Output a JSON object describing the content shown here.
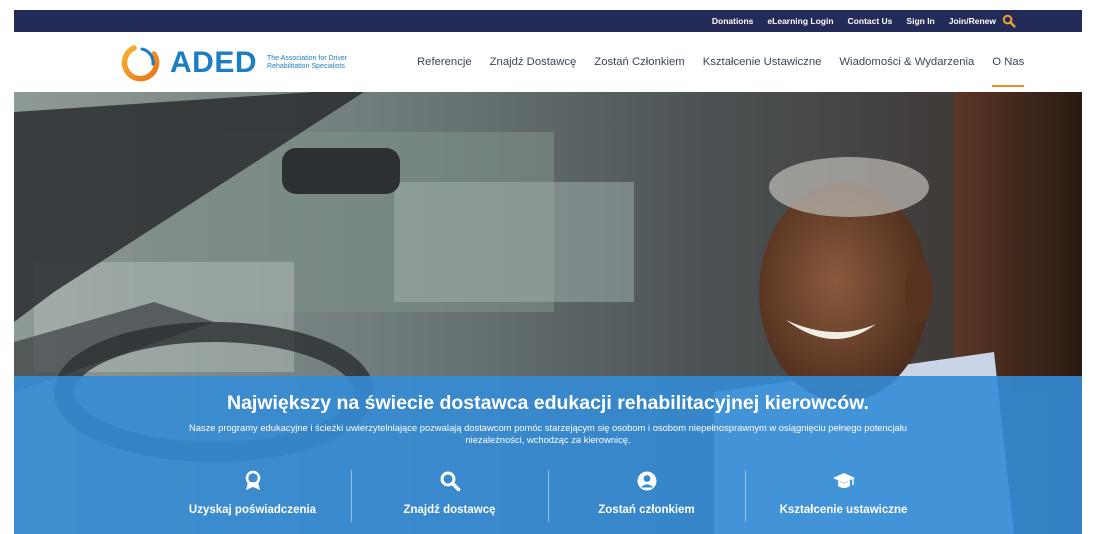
{
  "utility_bar": {
    "links": [
      "Donations",
      "eLearning Login",
      "Contact Us",
      "Sign In",
      "Join/Renew"
    ],
    "search_icon": "search-icon",
    "accent": "#f0a22b",
    "background": "#232c59"
  },
  "header": {
    "logo_text": "ADED",
    "logo_tagline": "The Association for Driver Rehabilitation Specialists",
    "logo_icon": "aded-ring-logo"
  },
  "nav": {
    "items": [
      "Referencje",
      "Znajdź Dostawcę",
      "Zostań Członkiem",
      "Kształcenie Ustawiczne",
      "Wiadomości & Wydarzenia",
      "O Nas"
    ],
    "active": "O Nas",
    "active_color": "#f08a24"
  },
  "hero": {
    "title": "Największy na świecie dostawca edukacji rehabilitacyjnej kierowców.",
    "subtitle": "Nasze programy edukacyjne i ścieżki uwierzytelniające pozwalają dostawcom pomóc starzejącym się osobom i osobom niepełnosprawnym w osiągnięciu pełnego potencjału niezależności, wchodząc za kierownicę.",
    "band_color": "#348cd6",
    "actions": [
      {
        "label": "Uzyskaj poświadczenia",
        "icon": "award-icon"
      },
      {
        "label": "Znajdź dostawcę",
        "icon": "search-icon"
      },
      {
        "label": "Zostań członkiem",
        "icon": "user-circle-icon"
      },
      {
        "label": "Kształcenie ustawiczne",
        "icon": "graduation-cap-icon"
      }
    ]
  }
}
